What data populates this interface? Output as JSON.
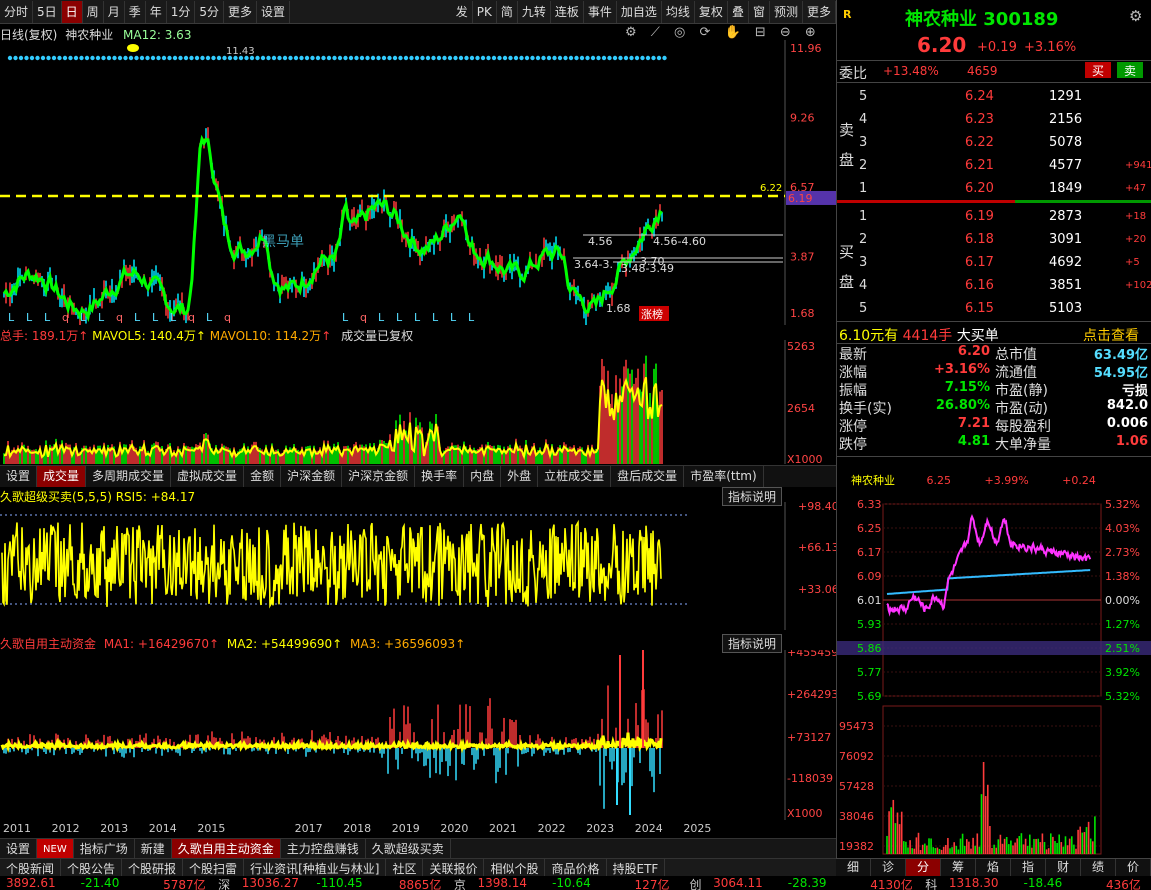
{
  "toolbar": {
    "items": [
      "分时",
      "5日",
      "日",
      "周",
      "月",
      "季",
      "年",
      "1分",
      "5分",
      "更多",
      "设置"
    ],
    "right_items": [
      "发",
      "PK",
      "简",
      "九转",
      "连板",
      "事件",
      "加自选",
      "均线",
      "复权",
      "叠",
      "窗",
      "预测",
      "更多"
    ]
  },
  "main_chart": {
    "title": "日线(复权)",
    "stock_name": "神农种业",
    "ma_label": "MA12: 3.63",
    "y_ticks": [
      "11.96",
      "9.26",
      "6.57",
      "3.87",
      "1.68"
    ],
    "high_label": "11.43",
    "price_line_label": "6.22",
    "price_tag": "6.19",
    "annotations": [
      "4.56",
      "4.56-4.60",
      "3.64-3.",
      "3.48-3.49",
      "3.70",
      "1.68",
      "涨榜",
      "黑马单"
    ],
    "markers": [
      "L",
      "L",
      "L",
      "q",
      "L",
      "L",
      "q",
      "L",
      "L",
      "L",
      "q",
      "L",
      "q",
      "L",
      "q",
      "L",
      "L",
      "L",
      "L",
      "L",
      "L"
    ]
  },
  "volume": {
    "label_total": "总手: 189.1万",
    "label_mavol5": "MAVOL5: 140.4万",
    "label_mavol10": "MAVOL10: 114.2万",
    "note": "成交量已复权",
    "y_ticks": [
      "5263",
      "2654",
      "X1000"
    ]
  },
  "tabs1": [
    "设置",
    "成交量",
    "多周期成交量",
    "虚拟成交量",
    "金额",
    "沪深金额",
    "沪深京金额",
    "换手率",
    "内盘",
    "外盘",
    "立桩成交量",
    "盘后成交量",
    "市盈率(ttm)"
  ],
  "rsi": {
    "label": "久歌超级买卖(5,5,5) RSI5: +84.17",
    "button": "指标说明",
    "y_ticks": [
      "+98.40",
      "+66.13",
      "+33.06"
    ]
  },
  "fund": {
    "title": "久歌自用主动资金",
    "ma1": "MA1: +16429670",
    "ma2": "MA2: +54499690",
    "ma3": "MA3: +36596093",
    "button": "指标说明",
    "y_ticks": [
      "+455459",
      "+264293",
      "+73127",
      "-118039",
      "X1000"
    ]
  },
  "years": [
    "2011",
    "2012",
    "2013",
    "2014",
    "2015",
    "2017",
    "2018",
    "2019",
    "2020",
    "2021",
    "2022",
    "2023",
    "2024",
    "2025"
  ],
  "bottom_tabs": [
    "设置",
    "NEW",
    "指标广场",
    "新建",
    "久歌自用主动资金",
    "主力控盘赚钱",
    "久歌超级买卖"
  ],
  "news_tabs": [
    "个股新闻",
    "个股公告",
    "个股研报",
    "个股扫雷",
    "行业资讯[种植业与林业]",
    "社区",
    "关联报价",
    "相似个股",
    "商品价格",
    "持股ETF"
  ],
  "status": [
    {
      "v": "3892.61",
      "c": "-21.40",
      "a": "5787亿",
      "n": "深"
    },
    {
      "v": "13036.27",
      "c": "-110.45",
      "a": "8865亿",
      "n": "京"
    },
    {
      "v": "1398.14",
      "c": "-10.64",
      "a": "127亿",
      "n": "创"
    },
    {
      "v": "3064.11",
      "c": "-28.39",
      "a": "4130亿",
      "n": "科"
    },
    {
      "v": "1318.30",
      "c": "-18.46",
      "a": "436亿",
      "n": ""
    }
  ],
  "quote": {
    "logo": "R",
    "name": "神农种业 300189",
    "price": "6.20",
    "change": "+0.19",
    "pct": "+3.16%",
    "webi_label": "委比",
    "webi": "+13.48%",
    "webi_vol": "4659",
    "buy_btn": "买",
    "sell_btn": "卖",
    "sell_label_1": "卖",
    "sell_label_2": "盘",
    "buy_label_1": "买",
    "buy_label_2": "盘",
    "asks": [
      {
        "lv": "5",
        "p": "6.24",
        "v": "1291",
        "d": ""
      },
      {
        "lv": "4",
        "p": "6.23",
        "v": "2156",
        "d": ""
      },
      {
        "lv": "3",
        "p": "6.22",
        "v": "5078",
        "d": ""
      },
      {
        "lv": "2",
        "p": "6.21",
        "v": "4577",
        "d": "+941"
      },
      {
        "lv": "1",
        "p": "6.20",
        "v": "1849",
        "d": "+47"
      }
    ],
    "bids": [
      {
        "lv": "1",
        "p": "6.19",
        "v": "2873",
        "d": "+18"
      },
      {
        "lv": "2",
        "p": "6.18",
        "v": "3091",
        "d": "+20"
      },
      {
        "lv": "3",
        "p": "6.17",
        "v": "4692",
        "d": "+5"
      },
      {
        "lv": "4",
        "p": "6.16",
        "v": "3851",
        "d": "+102"
      },
      {
        "lv": "5",
        "p": "6.15",
        "v": "5103",
        "d": ""
      }
    ],
    "big_order": "6.10元有",
    "big_vol": "4414手",
    "big_text": "大买单",
    "click_view": "点击查看",
    "stats": [
      [
        "最新",
        "6.20",
        "总市值",
        "63.49亿"
      ],
      [
        "涨幅",
        "+3.16%",
        "流通值",
        "54.95亿"
      ],
      [
        "振幅",
        "7.15%",
        "市盈(静)",
        "亏损"
      ],
      [
        "换手(实)",
        "26.80%",
        "市盈(动)",
        "842.0"
      ],
      [
        "涨停",
        "7.21",
        "每股盈利",
        "0.006"
      ],
      [
        "跌停",
        "4.81",
        "大单净量",
        "1.06"
      ]
    ]
  },
  "mini": {
    "name": "神农种业",
    "price": "6.25",
    "pct": "+3.99%",
    "chg": "+0.24",
    "left_ticks": [
      "6.33",
      "6.25",
      "6.17",
      "6.09",
      "6.01",
      "5.93",
      "5.86",
      "5.77",
      "5.69"
    ],
    "right_ticks": [
      "5.32%",
      "4.03%",
      "2.73%",
      "1.38%",
      "0.00%",
      "1.27%",
      "2.51%",
      "3.92%",
      "5.32%"
    ],
    "vol_ticks": [
      "95473",
      "76092",
      "57428",
      "38046",
      "19382"
    ],
    "tabs": [
      "细",
      "诊",
      "分",
      "筹",
      "焰",
      "指",
      "财",
      "绩",
      "价"
    ]
  },
  "chart_data": {
    "type": "candlestick",
    "x_range": [
      "2011",
      "2025"
    ],
    "ylim": [
      1.68,
      11.96
    ],
    "price_line": 6.22,
    "last": 6.19,
    "high": 11.43,
    "low": 1.68
  }
}
